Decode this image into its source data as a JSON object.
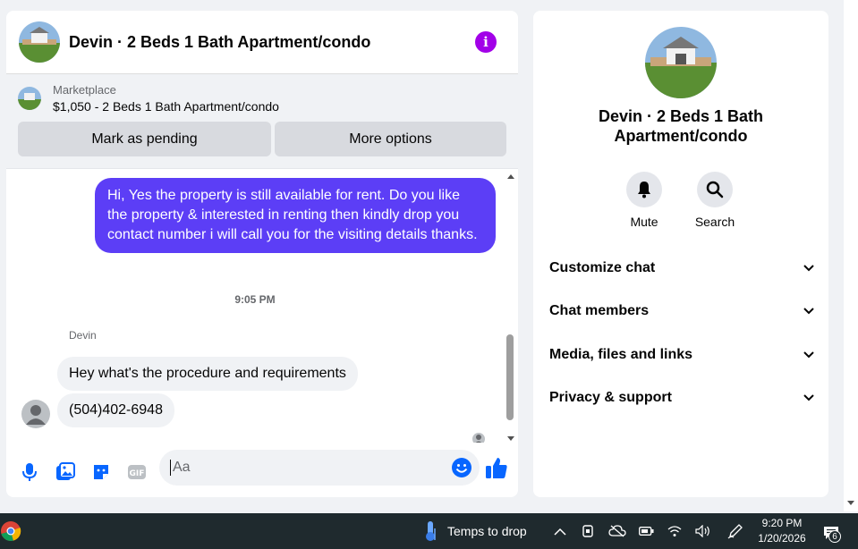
{
  "chat": {
    "title": "Devin · 2 Beds 1 Bath Apartment/condo",
    "info_icon": "info-icon",
    "marketplace_label": "Marketplace",
    "listing": "$1,050 - 2 Beds 1 Bath Apartment/condo",
    "buttons": {
      "pending": "Mark as pending",
      "more": "More options"
    },
    "messages": {
      "outgoing": "Hi, Yes the property is still available for rent. Do you like the property & interested in renting then kindly drop you contact number i will call you for the visiting details thanks.",
      "timestamp": "9:05 PM",
      "sender": "Devin",
      "incoming": [
        "Hey what's the procedure and requirements",
        "(504)402-6948"
      ]
    },
    "composer": {
      "placeholder": "Aa"
    },
    "colors": {
      "accent": "#5c3ef6",
      "brand": "#0866ff",
      "info": "#a200e8"
    }
  },
  "side": {
    "title_line1": "Devin · 2 Beds 1 Bath",
    "title_line2": "Apartment/condo",
    "actions": {
      "mute": "Mute",
      "search": "Search"
    },
    "sections": [
      "Customize chat",
      "Chat members",
      "Media, files and links",
      "Privacy & support"
    ]
  },
  "taskbar": {
    "weather": "Temps to drop",
    "time": "9:20 PM",
    "date": "1/20/2026",
    "notifications": "6"
  }
}
